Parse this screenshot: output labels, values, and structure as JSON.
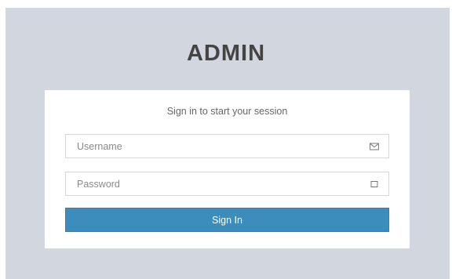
{
  "logo": {
    "text": "ADMIN"
  },
  "login": {
    "message": "Sign in to start your session",
    "username": {
      "placeholder": "Username",
      "value": "",
      "icon": "envelope-icon"
    },
    "password": {
      "placeholder": "Password",
      "value": "",
      "icon": "lock-icon"
    },
    "submit_label": "Sign In"
  },
  "colors": {
    "page_background": "#d2d6de",
    "button": "#3c8dbc",
    "logo_text": "#444444"
  }
}
